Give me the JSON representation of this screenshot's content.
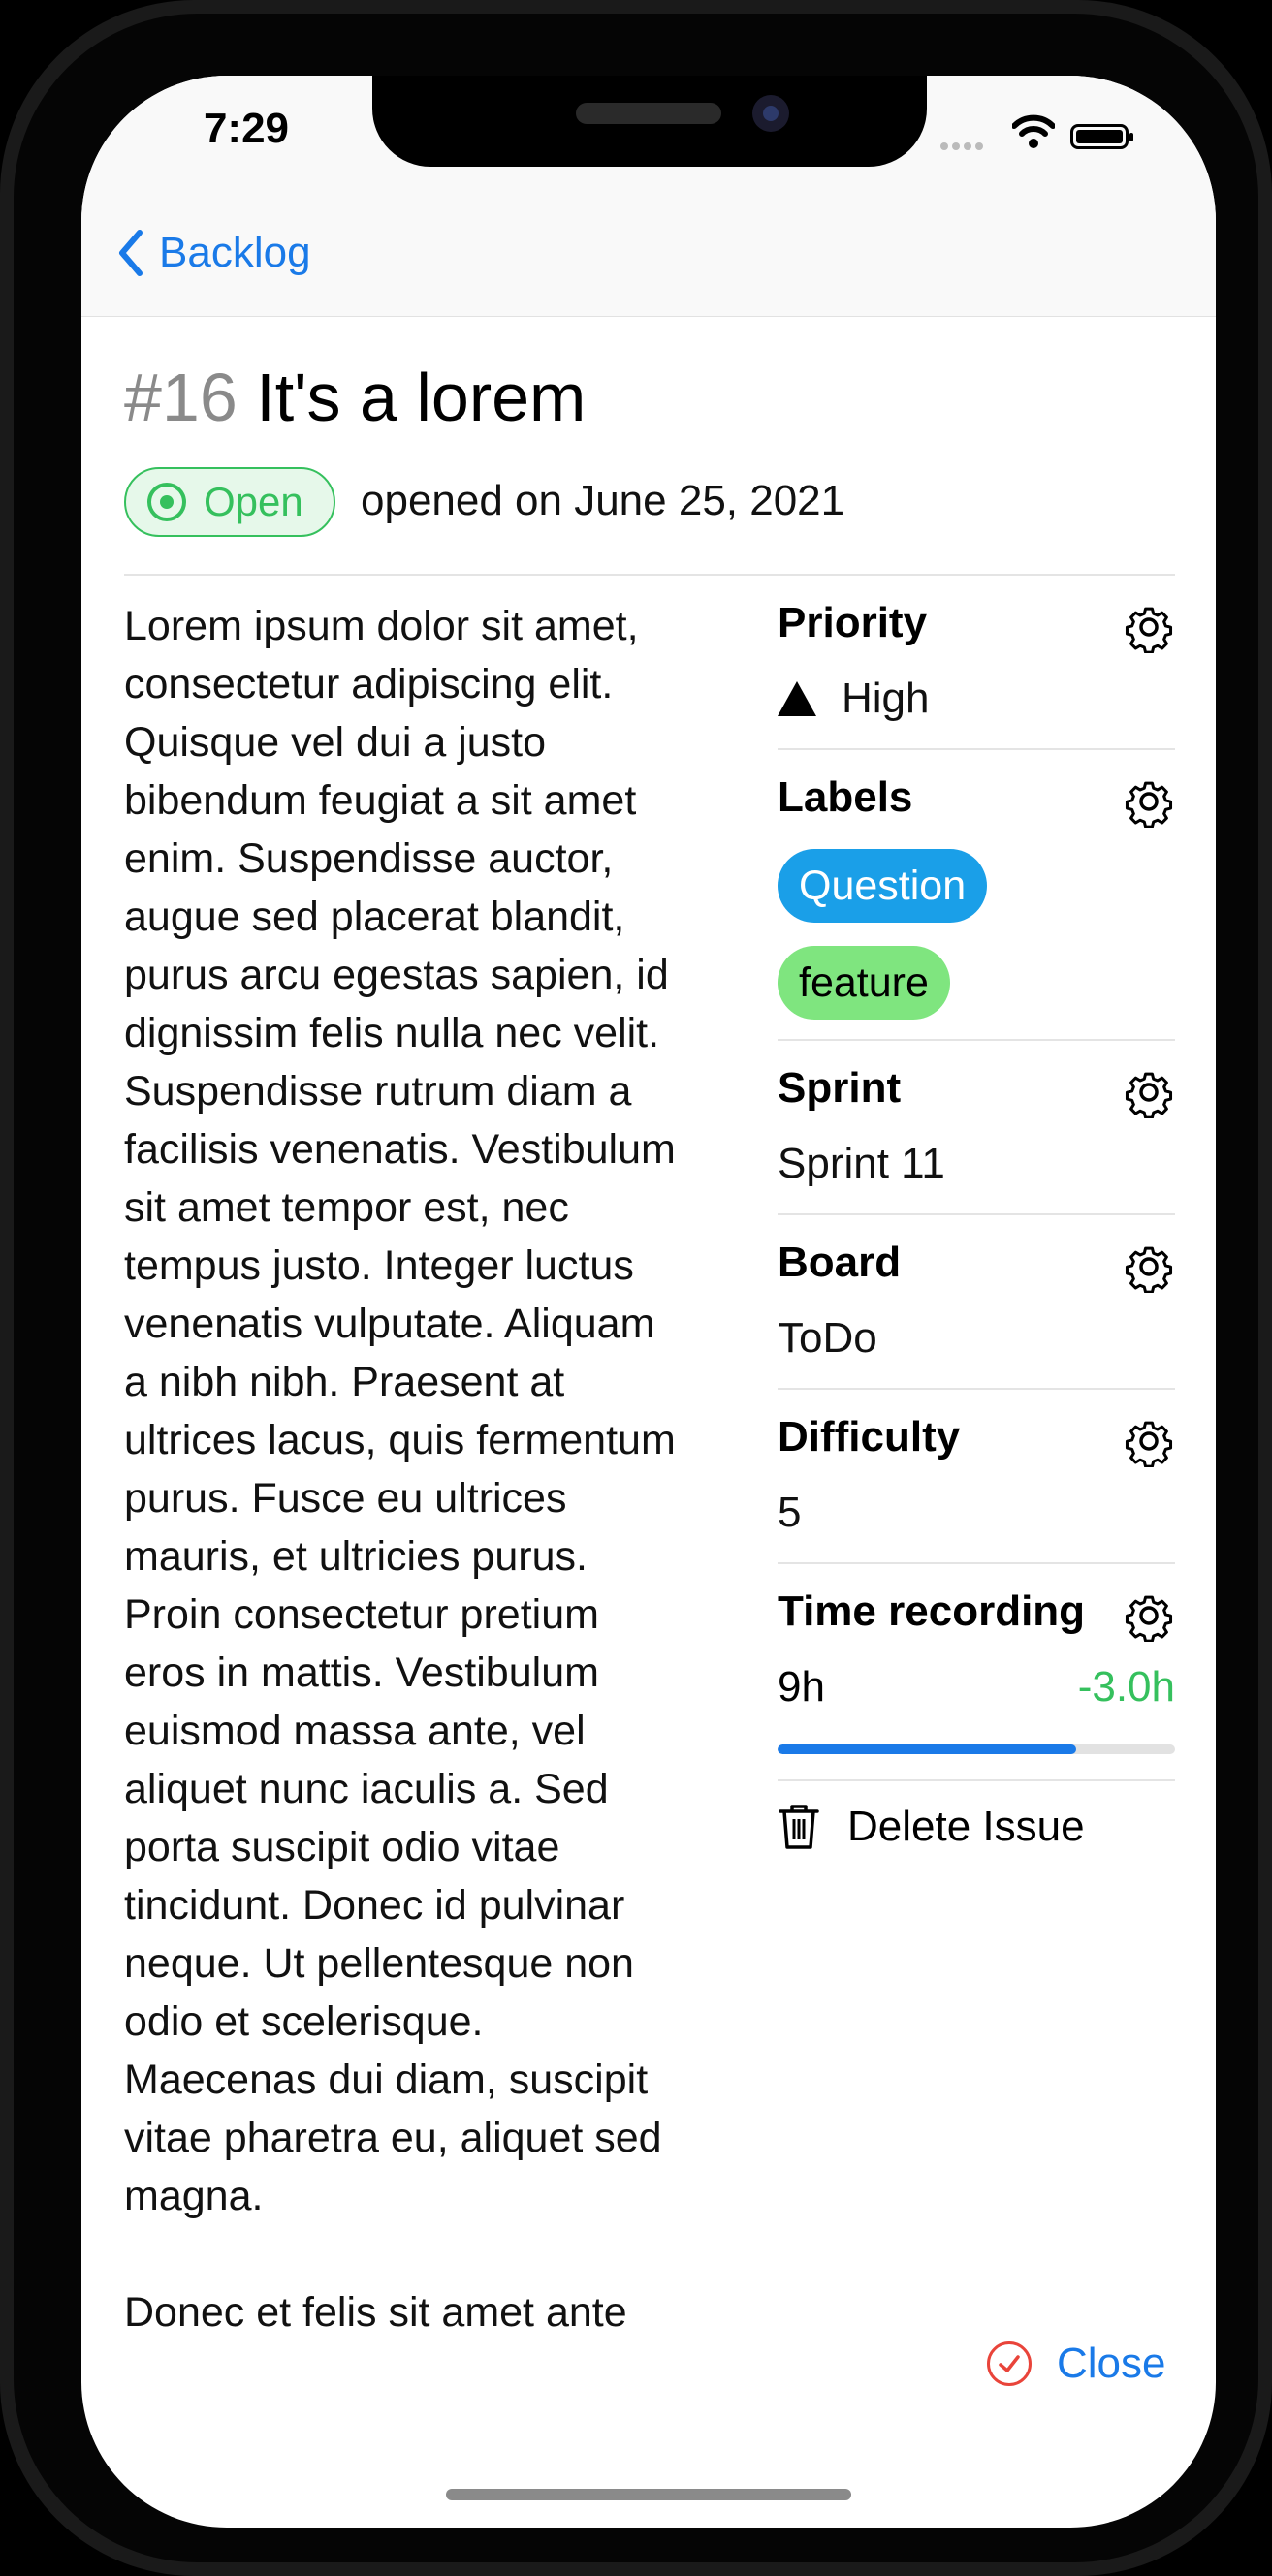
{
  "status_bar": {
    "time": "7:29"
  },
  "nav": {
    "back_label": "Backlog"
  },
  "issue": {
    "number": "#16",
    "title": "It's a lorem",
    "state": "Open",
    "opened_text": "opened on June 25, 2021",
    "body": "Lorem ipsum dolor sit amet,\nconsectetur adipiscing elit.\nQuisque vel dui a justo\nbibendum feugiat a sit amet\nenim. Suspendisse auctor,\naugue sed placerat blandit,\npurus arcu egestas sapien, id\ndignissim felis nulla nec velit.\nSuspendisse rutrum diam a\nfacilisis venenatis. Vestibulum\nsit amet tempor est, nec\ntempus justo. Integer luctus\nvenenatis vulputate. Aliquam\na nibh nibh. Praesent at\nultrices lacus, quis fermentum\npurus. Fusce eu ultrices\nmauris, et ultricies purus.\nProin consectetur pretium\neros in mattis. Vestibulum\neuismod massa ante, vel\naliquet nunc iaculis a. Sed\nporta suscipit odio vitae\ntincidunt. Donec id pulvinar\nneque. Ut pellentesque non\nodio et scelerisque.\nMaecenas dui diam, suscipit\nvitae pharetra eu, aliquet sed\nmagna.\n\nDonec et felis sit amet ante"
  },
  "sidebar": {
    "priority": {
      "label": "Priority",
      "value": "High",
      "icon": "triangle-icon"
    },
    "labels": {
      "label": "Labels",
      "items": [
        {
          "text": "Question",
          "color": "#1a9fe8",
          "text_color": "#ffffff"
        },
        {
          "text": "feature",
          "color": "#7fe57f",
          "text_color": "#000000"
        }
      ]
    },
    "sprint": {
      "label": "Sprint",
      "value": "Sprint 11"
    },
    "board": {
      "label": "Board",
      "value": "ToDo"
    },
    "difficulty": {
      "label": "Difficulty",
      "value": "5"
    },
    "time_recording": {
      "label": "Time recording",
      "value": "9h",
      "delta": "-3.0h",
      "progress": 0.75
    },
    "delete_label": "Delete Issue"
  },
  "footer": {
    "close_label": "Close"
  },
  "colors": {
    "accent": "#1a7ae8",
    "open_green": "#35c05d",
    "close_red": "#e9443a"
  }
}
